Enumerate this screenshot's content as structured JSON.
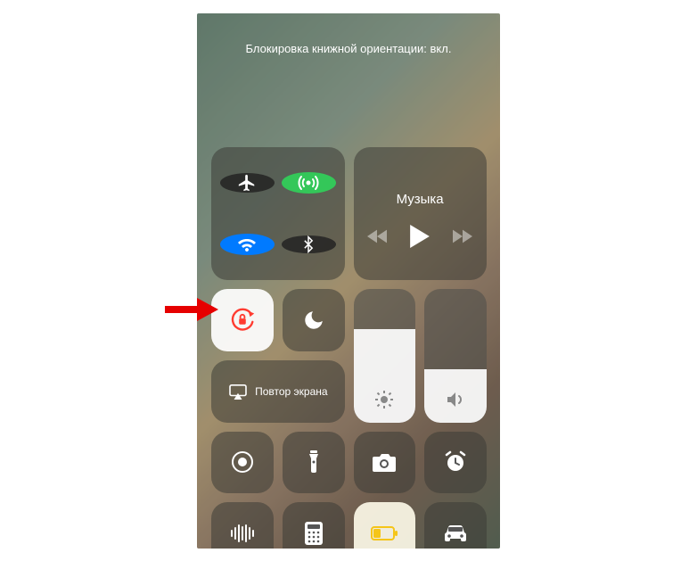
{
  "status_text": "Блокировка книжной ориентации: вкл.",
  "media": {
    "title": "Музыка"
  },
  "screen_mirror": {
    "label": "Повтор экрана"
  },
  "brightness": {
    "fill_percent": 70
  },
  "volume": {
    "fill_percent": 40
  }
}
